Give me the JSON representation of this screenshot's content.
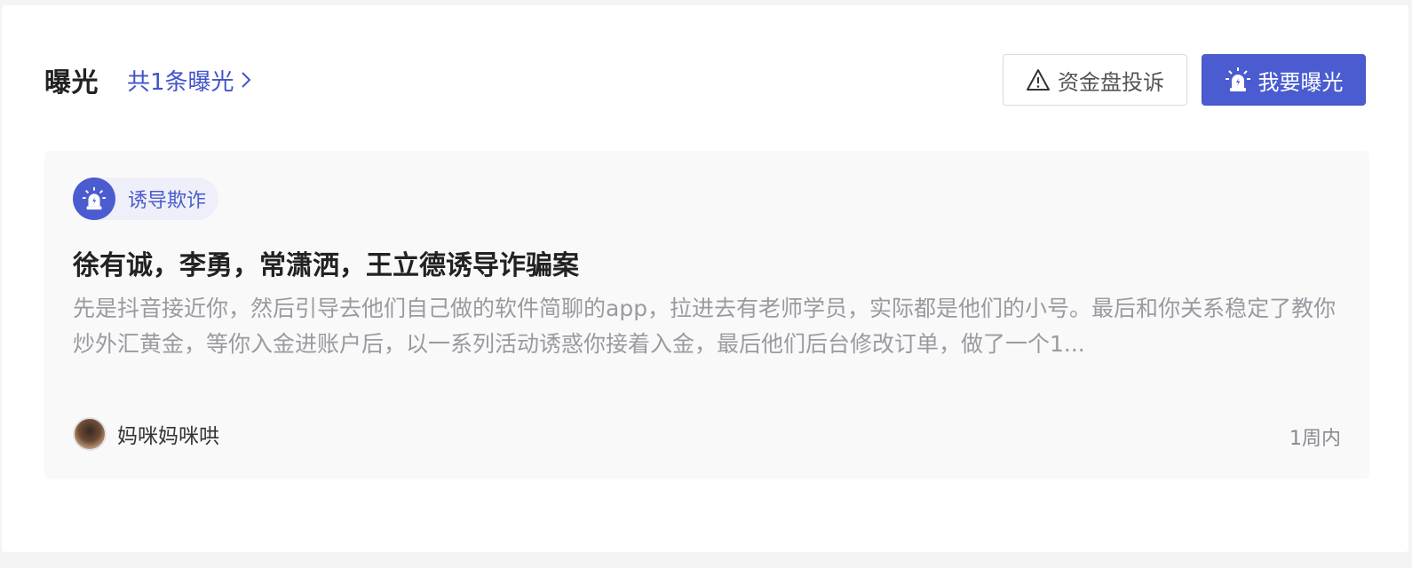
{
  "header": {
    "title": "曝光",
    "count_link": "共1条曝光",
    "complaint_button": "资金盘投诉",
    "expose_button": "我要曝光"
  },
  "card": {
    "tag": "诱导欺诈",
    "title": "徐有诚，李勇，常潇洒，王立德诱导诈骗案",
    "description": "先是抖音接近你，然后引导去他们自己做的软件简聊的app，拉进去有老师学员，实际都是他们的小号。最后和你关系稳定了教你炒外汇黄金，等你入金进账户后，以一系列活动诱惑你接着入金，最后他们后台修改订单，做了一个1...",
    "author": "妈咪妈咪哄",
    "time": "1周内"
  },
  "colors": {
    "accent": "#4a5cd0",
    "text_primary": "#222222",
    "text_muted": "#9a9aa0"
  },
  "icons": {
    "complaint": "warning-triangle-icon",
    "expose": "alarm-siren-icon",
    "link": "chevron-right-icon",
    "tag": "alarm-siren-icon"
  }
}
